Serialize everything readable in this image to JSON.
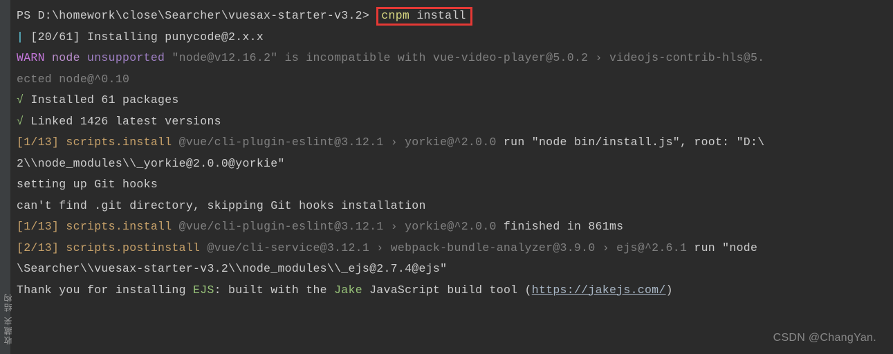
{
  "sidebar": {
    "label": "收藏夹  结构"
  },
  "term": {
    "prompt_prefix": "PS ",
    "prompt_path": "D:\\homework\\close\\Searcher\\vuesax-starter-v3.2>",
    "cmd1": "cnpm ",
    "cmd2": "install",
    "progress_bar": "|",
    "progress_text": " [20/61] Installing punycode@2.x.x",
    "warn_label": "WARN",
    "warn_node1": " node ",
    "warn_node2": "unsupported",
    "warn_msg": " \"node@v12.16.2\" is incompatible with vue-video-player@5.0.2 › videojs-contrib-hls@5.",
    "warn_line2": "ected node@^0.10",
    "check": "√",
    "installed": " Installed 61 packages",
    "linked": " Linked 1426 latest versions",
    "s1_tag": "[1/13]",
    "s1_label": " scripts.install ",
    "s1_pkg": "@vue/cli-plugin-eslint@3.12.1 › yorkie@^2.0.0",
    "s1_action": " run \"node bin/install.js\", root: \"D:\\",
    "s1_line2": "2\\\\node_modules\\\\_yorkie@2.0.0@yorkie\"",
    "hooks1": "setting up Git hooks",
    "hooks2": "can't find .git directory, skipping Git hooks installation",
    "s2_tag": "[1/13]",
    "s2_label": " scripts.install ",
    "s2_pkg": "@vue/cli-plugin-eslint@3.12.1 › yorkie@^2.0.0",
    "s2_action": " finished in 861ms",
    "s3_tag": "[2/13]",
    "s3_label": " scripts.postinstall ",
    "s3_pkg": "@vue/cli-service@3.12.1 › webpack-bundle-analyzer@3.9.0 › ejs@^2.6.1",
    "s3_action": " run \"node ",
    "s3_line2": "\\Searcher\\\\vuesax-starter-v3.2\\\\node_modules\\\\_ejs@2.7.4@ejs\"",
    "thanks1": "Thank you for installing ",
    "ejs": "EJS",
    "thanks2": ": built with the ",
    "jake": "Jake",
    "thanks3": " JavaScript build tool (",
    "link": "https://jakejs.com/",
    "thanks4": ")"
  },
  "watermark": "CSDN @ChangYan."
}
